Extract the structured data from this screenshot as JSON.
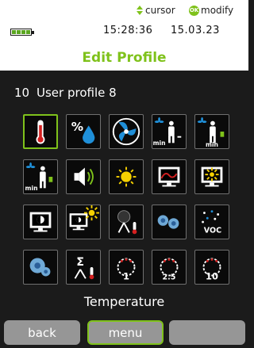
{
  "hints": {
    "cursor": "cursor",
    "ok_badge": "OK",
    "modify": "modify"
  },
  "status": {
    "time": "15:28:36",
    "date": "15.03.23",
    "battery_level": 1.0
  },
  "title": "Edit Profile",
  "profile": {
    "number": "10",
    "name": "User profile 8"
  },
  "icons": [
    {
      "name": "temperature-icon",
      "selected": true
    },
    {
      "name": "humidity-icon",
      "label": "%"
    },
    {
      "name": "fan-icon"
    },
    {
      "name": "min-fan-presence-icon",
      "label": "min"
    },
    {
      "name": "min-fan-presence-alt-icon",
      "label": "min"
    },
    {
      "name": "min-presence-icon",
      "label": "min"
    },
    {
      "name": "sound-icon"
    },
    {
      "name": "brightness-icon"
    },
    {
      "name": "display-curve-icon"
    },
    {
      "name": "display-brightness-icon"
    },
    {
      "name": "screen-contrast-icon"
    },
    {
      "name": "screen-sun-icon"
    },
    {
      "name": "globe-temperature-icon"
    },
    {
      "name": "particles-icon"
    },
    {
      "name": "voc-icon",
      "label": "VOC"
    },
    {
      "name": "particle-sensor-icon"
    },
    {
      "name": "sum-temperature-icon",
      "label": "Σ"
    },
    {
      "name": "pm1-icon",
      "label": "1"
    },
    {
      "name": "pm25-icon",
      "label": "2.5"
    },
    {
      "name": "pm10-icon",
      "label": "10"
    }
  ],
  "selected_label": "Temperature",
  "softkeys": {
    "back": "back",
    "menu": "menu",
    "blank": ""
  },
  "colors": {
    "accent": "#7fc21b",
    "background": "#1b1b1b",
    "softkey": "#969696"
  }
}
